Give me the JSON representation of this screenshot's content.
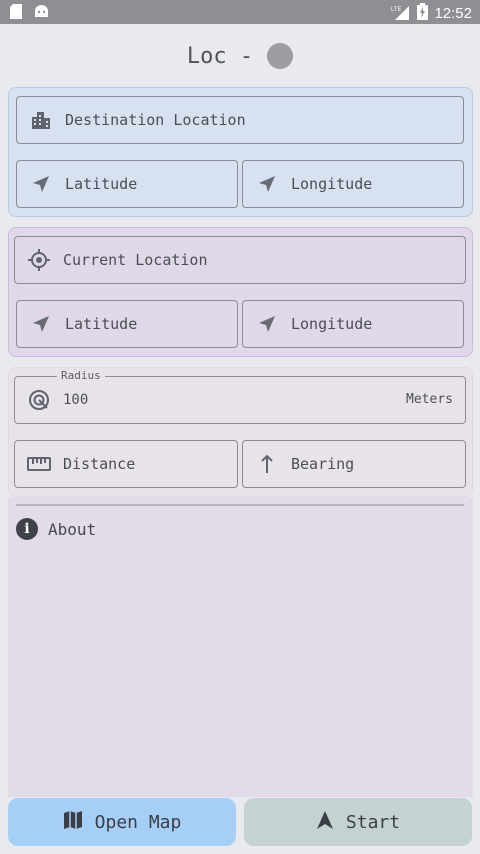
{
  "status_bar": {
    "time": "12:52",
    "network": "LTE",
    "icons": [
      "sd-card-icon",
      "android-icon",
      "signal-icon",
      "battery-icon"
    ]
  },
  "header": {
    "title": "Loc -",
    "status_indicator_color": "#9c9da3"
  },
  "destination": {
    "location_label": "Destination Location",
    "latitude_label": "Latitude",
    "longitude_label": "Longitude",
    "panel_color": "#d7e1ef"
  },
  "current": {
    "location_label": "Current Location",
    "latitude_label": "Latitude",
    "longitude_label": "Longitude",
    "panel_color": "#e0d8e8"
  },
  "radius": {
    "legend": "Radius",
    "value": "100",
    "unit": "Meters",
    "distance_label": "Distance",
    "bearing_label": "Bearing"
  },
  "about": {
    "label": "About"
  },
  "actions": {
    "open_map_label": "Open Map",
    "start_label": "Start",
    "open_map_color": "#a6cff8",
    "start_color": "#c4d2d3"
  }
}
